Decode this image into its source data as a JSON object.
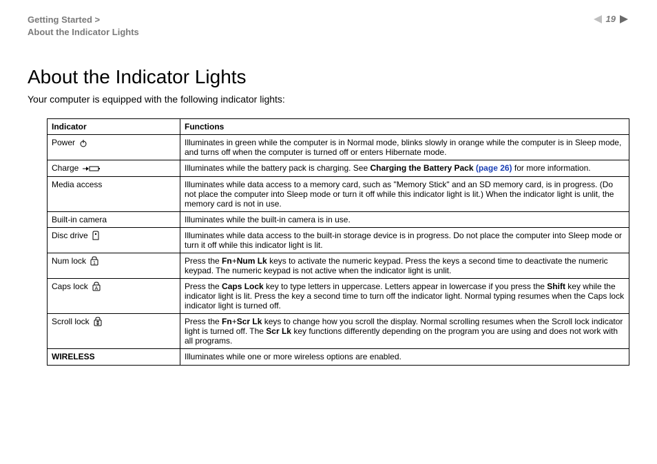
{
  "header": {
    "breadcrumb_line1": "Getting Started >",
    "breadcrumb_line2": "About the Indicator Lights",
    "page_number": "19"
  },
  "title": "About the Indicator Lights",
  "intro": "Your computer is equipped with the following indicator lights:",
  "table": {
    "head_indicator": "Indicator",
    "head_functions": "Functions",
    "rows": {
      "power": {
        "name": "Power",
        "func": "Illuminates in green while the computer is in Normal mode, blinks slowly in orange while the computer is in Sleep mode, and turns off when the computer is turned off or enters Hibernate mode."
      },
      "charge": {
        "name": "Charge",
        "func_prefix": "Illuminates while the battery pack is charging. See ",
        "func_link_label": "Charging the Battery Pack ",
        "func_link_page": "(page 26)",
        "func_suffix": " for more information."
      },
      "media": {
        "name": "Media access",
        "func": "Illuminates while data access to a memory card, such as \"Memory Stick\" and an SD memory card, is in progress. (Do not place the computer into Sleep mode or turn it off while this indicator light is lit.) When the indicator light is unlit, the memory card is not in use."
      },
      "camera": {
        "name": "Built-in camera",
        "func": "Illuminates while the built-in camera is in use."
      },
      "disc": {
        "name": "Disc drive",
        "func": "Illuminates while data access to the built-in storage device is in progress. Do not place the computer into Sleep mode or turn it off while this indicator light is lit."
      },
      "numlock": {
        "name": "Num lock",
        "func_prefix": "Press the ",
        "func_key1": "Fn",
        "func_plus1": "+",
        "func_key2": "Num Lk",
        "func_suffix": " keys to activate the numeric keypad. Press the keys a second time to deactivate the numeric keypad. The numeric keypad is not active when the indicator light is unlit."
      },
      "capslock": {
        "name": "Caps lock",
        "func_prefix": "Press the ",
        "func_key1": "Caps Lock",
        "func_mid1": " key to type letters in uppercase. Letters appear in lowercase if you press the ",
        "func_key2": "Shift",
        "func_suffix": " key while the indicator light is lit. Press the key a second time to turn off the indicator light. Normal typing resumes when the Caps lock indicator light is turned off."
      },
      "scrolllock": {
        "name": "Scroll lock",
        "func_prefix": "Press the ",
        "func_key1": "Fn",
        "func_plus1": "+",
        "func_key2": "Scr Lk",
        "func_mid": " keys to change how you scroll the display. Normal scrolling resumes when the Scroll lock indicator light is turned off. The ",
        "func_key3": "Scr Lk",
        "func_suffix": " key functions differently depending on the program you are using and does not work with all programs."
      },
      "wireless": {
        "name": "WIRELESS",
        "func": "Illuminates while one or more wireless options are enabled."
      }
    }
  }
}
